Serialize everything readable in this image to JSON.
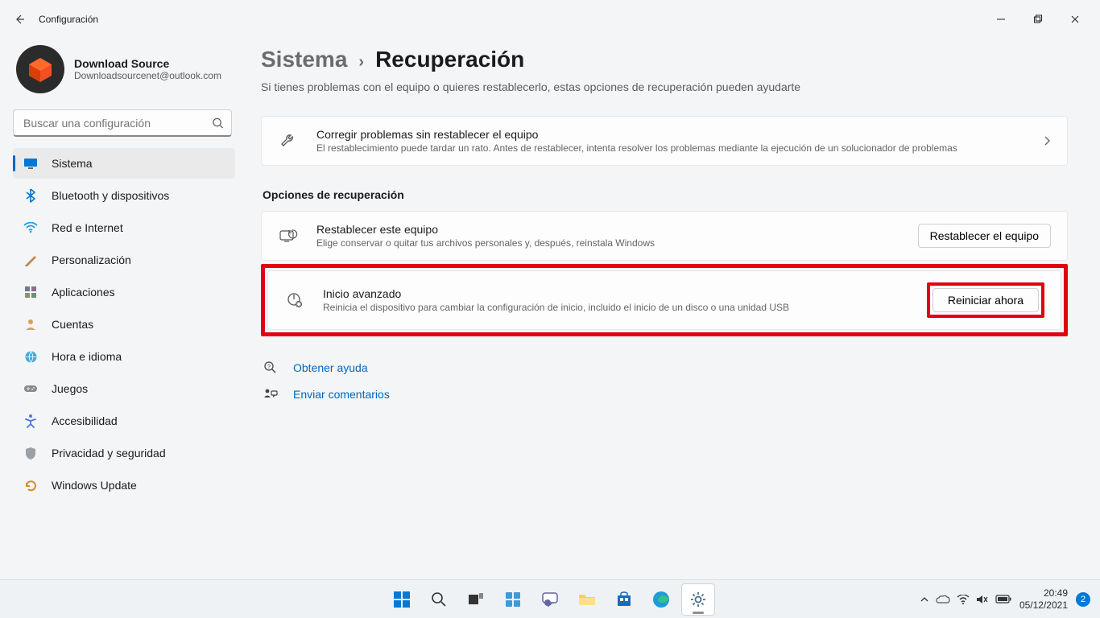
{
  "window": {
    "title": "Configuración"
  },
  "profile": {
    "name": "Download Source",
    "email": "Downloadsourcenet@outlook.com"
  },
  "search": {
    "placeholder": "Buscar una configuración"
  },
  "nav": {
    "items": [
      {
        "label": "Sistema",
        "icon": "display",
        "selected": true
      },
      {
        "label": "Bluetooth y dispositivos",
        "icon": "bluetooth"
      },
      {
        "label": "Red e Internet",
        "icon": "wifi"
      },
      {
        "label": "Personalización",
        "icon": "brush"
      },
      {
        "label": "Aplicaciones",
        "icon": "apps"
      },
      {
        "label": "Cuentas",
        "icon": "person"
      },
      {
        "label": "Hora e idioma",
        "icon": "globe"
      },
      {
        "label": "Juegos",
        "icon": "gamepad"
      },
      {
        "label": "Accesibilidad",
        "icon": "accessibility"
      },
      {
        "label": "Privacidad y seguridad",
        "icon": "shield"
      },
      {
        "label": "Windows Update",
        "icon": "update"
      }
    ]
  },
  "breadcrumb": {
    "parent": "Sistema",
    "current": "Recuperación"
  },
  "intro": "Si tienes problemas con el equipo o quieres restablecerlo, estas opciones de recuperación pueden ayudarte",
  "fix_card": {
    "title": "Corregir problemas sin restablecer el equipo",
    "desc": "El restablecimiento puede tardar un rato. Antes de restablecer, intenta resolver los problemas mediante la ejecución de un solucionador de problemas"
  },
  "section_title": "Opciones de recuperación",
  "reset_card": {
    "title": "Restablecer este equipo",
    "desc": "Elige conservar o quitar tus archivos personales y, después, reinstala Windows",
    "button": "Restablecer el equipo"
  },
  "advanced_card": {
    "title": "Inicio avanzado",
    "desc": "Reinicia el dispositivo para cambiar la configuración de inicio, incluido el inicio de un disco o una unidad USB",
    "button": "Reiniciar ahora"
  },
  "help_link": "Obtener ayuda",
  "feedback_link": "Enviar comentarios",
  "taskbar": {
    "time": "20:49",
    "date": "05/12/2021",
    "notif_count": "2"
  }
}
